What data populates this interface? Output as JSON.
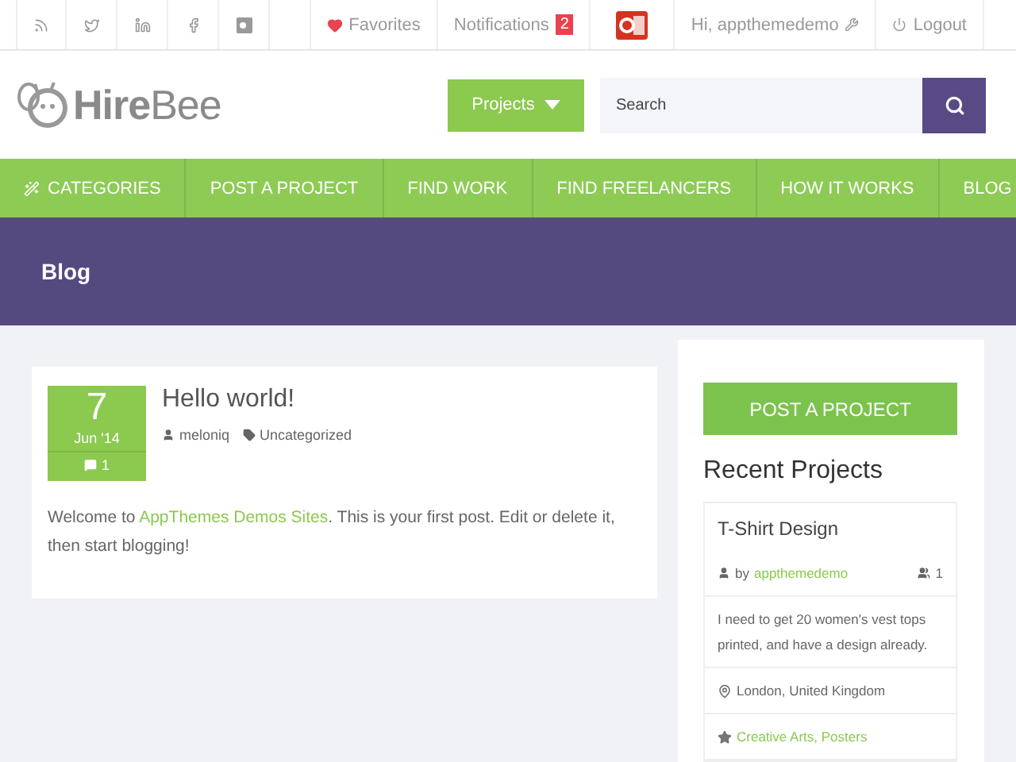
{
  "top_bar": {
    "social_links": [
      {
        "kind": "rss"
      },
      {
        "kind": "twitter"
      },
      {
        "kind": "linkedin"
      },
      {
        "kind": "facebook"
      },
      {
        "kind": "google_plus"
      }
    ],
    "favorites": "Favorites",
    "notifications": {
      "label": "Notifications",
      "count": "2"
    },
    "user": "Hi, appthemedemo",
    "logout": "Logout"
  },
  "header": {
    "logo": "**Hire**Bee",
    "projects_button": "Projects",
    "search": {
      "placeholder": "Search"
    }
  },
  "nav": [
    {
      "label": "CATEGORIES",
      "kind": "categories"
    },
    {
      "label": "POST A PROJECT"
    },
    {
      "label": "FIND WORK"
    },
    {
      "label": "FIND FREELANCERS"
    },
    {
      "label": "HOW IT WORKS"
    },
    {
      "label": "BLOG"
    }
  ],
  "banner": {
    "title": "Blog"
  },
  "post": {
    "day": "7",
    "month": "Jun '14",
    "comments": "1",
    "title": "Hello world!",
    "author": "meloniq",
    "category": "Uncategorized",
    "body_start": "Welcome to",
    "body_link": "AppThemes Demos Sites",
    "body_end": ". This is your first post. Edit or delete it, then start blogging!"
  },
  "sidebar": {
    "post_button": "POST A PROJECT",
    "heading": "Recent Projects",
    "project": {
      "title": "T-Shirt Design",
      "by": "by",
      "author": "appthemedemo",
      "bids": "1",
      "description": "I need to get 20 women's vest tops printed, and have a design already.",
      "location": "London, United Kingdom",
      "categories": "Creative Arts, Posters"
    }
  }
}
